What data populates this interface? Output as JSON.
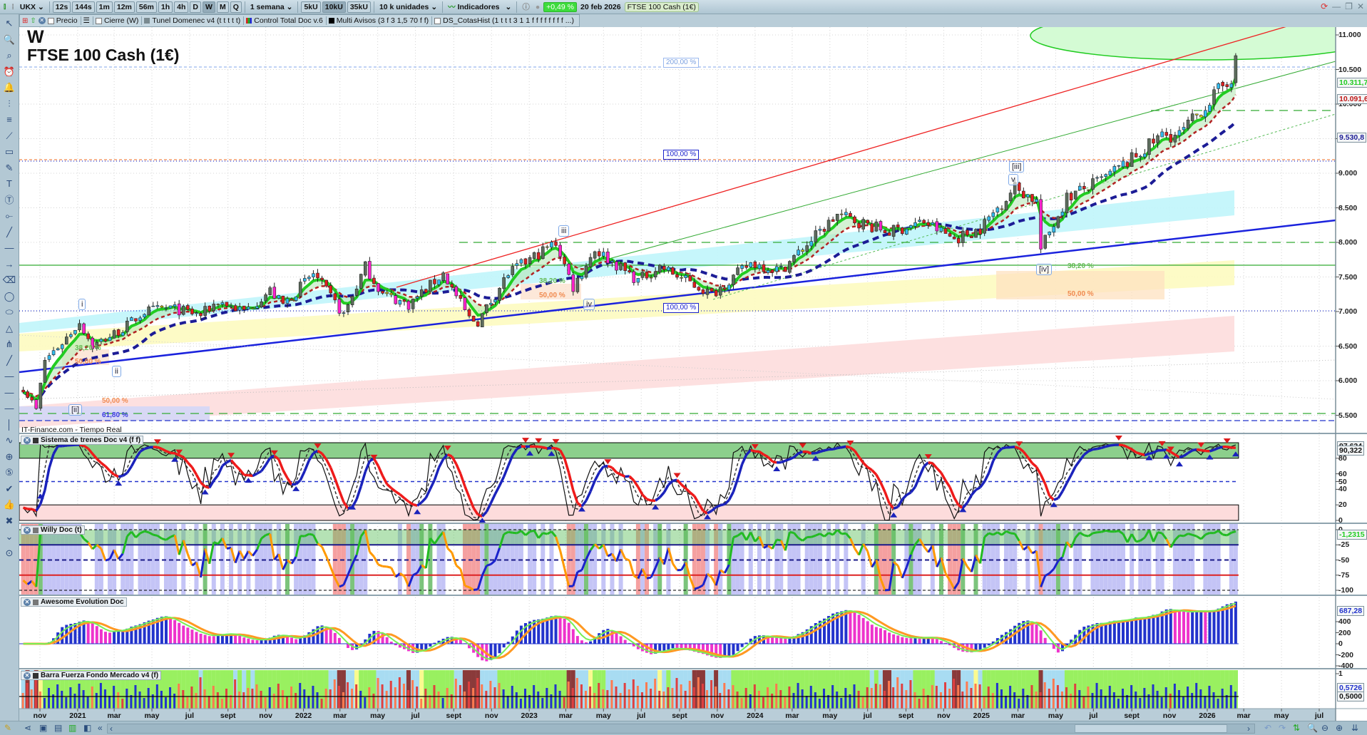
{
  "toolbar": {
    "symbol": "UKX",
    "timeframes": [
      "12s",
      "144s",
      "1m",
      "12m",
      "56m",
      "1h",
      "4h",
      "D",
      "W",
      "M",
      "Q"
    ],
    "active_timeframe": "W",
    "period": "1 semana",
    "units": [
      "5kU",
      "10kU",
      "35kU"
    ],
    "active_unit": "10kU",
    "units_select": "10 k unidades",
    "indicators": "Indicadores",
    "change": "+0,49 %",
    "date": "20 feb 2026",
    "instrument": "FTSE 100 Cash (1€)",
    "colors": {
      "change_bg": "#3ddc3d"
    }
  },
  "legend": {
    "precio": "Precio",
    "cierre": "Cierre (W)",
    "tunel": "Tunel Domenec v4 (t t t t t)",
    "control": "Control Total Doc v.6",
    "multi": "Multi Avisos (3 f 3 1,5 70 f f)",
    "cotas": "DS_CotasHist (1 t t t 3 1 1 f f f f f f f f ...)"
  },
  "left_tools": [
    {
      "name": "cursor-icon",
      "glyph": "↖"
    },
    {
      "name": "zoom-icon",
      "glyph": "🔍"
    },
    {
      "name": "zoom-range-icon",
      "glyph": "⌕"
    },
    {
      "name": "alarm-icon",
      "glyph": "⏰"
    },
    {
      "name": "alert-icon",
      "glyph": "🔔"
    },
    {
      "name": "fibo-icon",
      "glyph": "⫶"
    },
    {
      "name": "fibo-levels-icon",
      "glyph": "≡"
    },
    {
      "name": "channel-icon",
      "glyph": "⟋"
    },
    {
      "name": "rectangle-icon",
      "glyph": "▭"
    },
    {
      "name": "pencil-icon",
      "glyph": "✎"
    },
    {
      "name": "text-icon",
      "glyph": "T"
    },
    {
      "name": "text-box-icon",
      "glyph": "Ⓣ"
    },
    {
      "name": "ruler-icon",
      "glyph": "⟜"
    },
    {
      "name": "trend-line-icon",
      "glyph": "╱"
    },
    {
      "name": "hline-icon",
      "glyph": "—"
    },
    {
      "name": "arrow-line-icon",
      "glyph": "→"
    },
    {
      "name": "eraser-icon",
      "glyph": "⌫"
    },
    {
      "name": "circle-icon",
      "glyph": "◯"
    },
    {
      "name": "ellipse-icon",
      "glyph": "⬭"
    },
    {
      "name": "triangle-icon",
      "glyph": "△"
    },
    {
      "name": "pitchfork-icon",
      "glyph": "⋔"
    },
    {
      "name": "red-line-icon",
      "glyph": "╱"
    },
    {
      "name": "black-line-icon",
      "glyph": "—"
    },
    {
      "name": "green-line-icon",
      "glyph": "—"
    },
    {
      "name": "blue-line-icon",
      "glyph": "—"
    },
    {
      "name": "vline-icon",
      "glyph": "│"
    },
    {
      "name": "wave-icon",
      "glyph": "∿"
    },
    {
      "name": "target-icon",
      "glyph": "⊕"
    },
    {
      "name": "elliott-icon",
      "glyph": "⑤"
    },
    {
      "name": "check-icon",
      "glyph": "✔"
    },
    {
      "name": "thumb-icon",
      "glyph": "👍"
    },
    {
      "name": "delete-icon",
      "glyph": "✖"
    },
    {
      "name": "expand-icon",
      "glyph": "⌄"
    },
    {
      "name": "magnet-icon",
      "glyph": "⊙"
    }
  ],
  "chart": {
    "timeframe_label": "W",
    "title": "FTSE 100 Cash (1€)",
    "source": "IT-Finance.com - Tiempo Real",
    "waves": {
      "i": "i",
      "ii": "ii",
      "ii_major": "[ii]",
      "iii": "iii",
      "iv": "iv",
      "iii_major": "[iii]",
      "v": "v",
      "iv_major": "[iv]"
    },
    "fibs": {
      "p200": "200,00 %",
      "p100a": "100,00 %",
      "p100b": "100,00 %",
      "f382a": "38,20 %",
      "f500a": "50,00 %",
      "f500b": "50,00 %",
      "f618": "61,80 %",
      "f382b": "38,20 %",
      "f500c": "50,00 %",
      "f382c": "38,20 %",
      "f500d": "50,00 %"
    },
    "markers": {
      "ema_fast": "10.311,7",
      "ema_slow": "10.091,6",
      "sma": "9.530,8"
    },
    "colors": {
      "ema_fast": "#22cc22",
      "ema_slow": "#b22222",
      "sma": "#1c1c96",
      "trend_blue": "#1a22dd",
      "trend_red": "#ee2222",
      "trend_green": "#33aa33"
    }
  },
  "chart_data": {
    "type": "candlestick",
    "title": "FTSE 100 Cash (1€)",
    "timeframe": "weekly",
    "start_week": "2020-10-05",
    "weeks": 281,
    "anchors": [
      [
        "2020-10-05",
        5900
      ],
      [
        "2020-10-26",
        5580
      ],
      [
        "2020-11-09",
        6300
      ],
      [
        "2020-12-07",
        6550
      ],
      [
        "2021-01-04",
        6850
      ],
      [
        "2021-01-25",
        6500
      ],
      [
        "2021-03-15",
        6750
      ],
      [
        "2021-04-19",
        7000
      ],
      [
        "2021-05-31",
        7050
      ],
      [
        "2021-07-19",
        6950
      ],
      [
        "2021-08-16",
        7150
      ],
      [
        "2021-09-27",
        7000
      ],
      [
        "2021-11-08",
        7300
      ],
      [
        "2021-11-29",
        7100
      ],
      [
        "2022-01-17",
        7550
      ],
      [
        "2022-03-07",
        6950
      ],
      [
        "2022-04-11",
        7650
      ],
      [
        "2022-05-09",
        7250
      ],
      [
        "2022-06-20",
        7100
      ],
      [
        "2022-08-15",
        7550
      ],
      [
        "2022-09-26",
        6900
      ],
      [
        "2022-10-10",
        6850
      ],
      [
        "2022-11-28",
        7550
      ],
      [
        "2023-02-13",
        8000
      ],
      [
        "2023-03-13",
        7350
      ],
      [
        "2023-04-17",
        7900
      ],
      [
        "2023-06-26",
        7450
      ],
      [
        "2023-07-31",
        7650
      ],
      [
        "2023-10-23",
        7250
      ],
      [
        "2023-12-25",
        7700
      ],
      [
        "2024-02-12",
        7600
      ],
      [
        "2024-05-13",
        8400
      ],
      [
        "2024-08-05",
        8150
      ],
      [
        "2024-09-30",
        8300
      ],
      [
        "2024-11-18",
        8050
      ],
      [
        "2024-12-30",
        8200
      ],
      [
        "2025-02-24",
        8800
      ],
      [
        "2025-03-31",
        8600
      ],
      [
        "2025-04-07",
        7900
      ],
      [
        "2025-05-19",
        8650
      ],
      [
        "2025-07-14",
        8900
      ],
      [
        "2025-09-01",
        9200
      ],
      [
        "2025-10-20",
        9550
      ],
      [
        "2025-11-17",
        9550
      ],
      [
        "2026-01-05",
        10050
      ],
      [
        "2026-02-09",
        10400
      ],
      [
        "2026-02-16",
        10700
      ]
    ],
    "price_ticks": [
      [
        11000,
        "11.000"
      ],
      [
        10500,
        "10.500"
      ],
      [
        10000,
        "10.000"
      ],
      [
        9500,
        "9.500"
      ],
      [
        9000,
        "9.000"
      ],
      [
        8500,
        "8.500"
      ],
      [
        8000,
        "8.000"
      ],
      [
        7500,
        "7.500"
      ],
      [
        7000,
        "7.000"
      ],
      [
        6500,
        "6.500"
      ],
      [
        6000,
        "6.000"
      ],
      [
        5500,
        "5.500"
      ]
    ],
    "x_ticks": [
      [
        "2020-11-01",
        "nov"
      ],
      [
        "2021-01-01",
        "2021"
      ],
      [
        "2021-03-01",
        "mar"
      ],
      [
        "2021-05-01",
        "may"
      ],
      [
        "2021-07-01",
        "jul"
      ],
      [
        "2021-09-01",
        "sept"
      ],
      [
        "2021-11-01",
        "nov"
      ],
      [
        "2022-01-01",
        "2022"
      ],
      [
        "2022-03-01",
        "mar"
      ],
      [
        "2022-05-01",
        "may"
      ],
      [
        "2022-07-01",
        "jul"
      ],
      [
        "2022-09-01",
        "sept"
      ],
      [
        "2022-11-01",
        "nov"
      ],
      [
        "2023-01-01",
        "2023"
      ],
      [
        "2023-03-01",
        "mar"
      ],
      [
        "2023-05-01",
        "may"
      ],
      [
        "2023-07-01",
        "jul"
      ],
      [
        "2023-09-01",
        "sept"
      ],
      [
        "2023-11-01",
        "nov"
      ],
      [
        "2024-01-01",
        "2024"
      ],
      [
        "2024-03-01",
        "mar"
      ],
      [
        "2024-05-01",
        "may"
      ],
      [
        "2024-07-01",
        "jul"
      ],
      [
        "2024-09-01",
        "sept"
      ],
      [
        "2024-11-01",
        "nov"
      ],
      [
        "2025-01-01",
        "2025"
      ],
      [
        "2025-03-01",
        "mar"
      ],
      [
        "2025-05-01",
        "may"
      ],
      [
        "2025-07-01",
        "jul"
      ],
      [
        "2025-09-01",
        "sept"
      ],
      [
        "2025-11-01",
        "nov"
      ],
      [
        "2026-01-01",
        "2026"
      ],
      [
        "2026-03-01",
        "mar"
      ],
      [
        "2026-05-01",
        "may"
      ],
      [
        "2026-07-01",
        "jul"
      ]
    ],
    "panels": {
      "trenes": {
        "name": "Sistema de trenes Doc v4 (f f)",
        "range": [
          0,
          100
        ],
        "ticks": [
          "80",
          "60",
          "50",
          "40",
          "20",
          "0"
        ],
        "tick_values": [
          80,
          60,
          50,
          40,
          20,
          0
        ],
        "value": "90,322",
        "value2": "97,624"
      },
      "willy": {
        "name": "Willy Doc (t)",
        "range": [
          -100,
          0
        ],
        "ticks": [
          "0",
          "-25",
          "-50",
          "-75",
          "-100"
        ],
        "tick_values": [
          0,
          -25,
          -50,
          -75,
          -100
        ],
        "value": "-1,2315"
      },
      "awesome": {
        "name": "Awesome Evolution Doc",
        "ticks": [
          "400",
          "200",
          "0",
          "-200",
          "-400"
        ],
        "tick_values": [
          400,
          200,
          0,
          -200,
          -400
        ],
        "value": "687,28"
      },
      "barra": {
        "name": "Barra Fuerza Fondo Mercado v4 (f)",
        "ticks": [
          "1"
        ],
        "tick_values": [
          1
        ],
        "value": "0,5726",
        "value2": "0,5000"
      }
    }
  },
  "bottom": {
    "collapse": "«",
    "scroll_left": "‹",
    "scroll_right": "›"
  }
}
